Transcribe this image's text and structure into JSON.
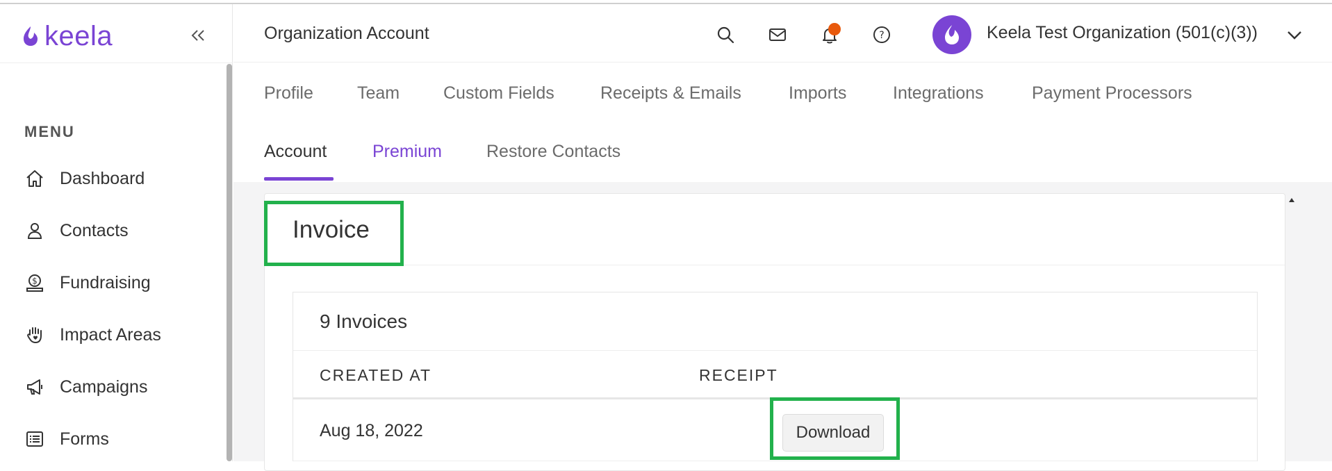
{
  "brand": {
    "logo_text": "keela",
    "accent": "#7a44d4"
  },
  "sidebar": {
    "menu_heading": "MENU",
    "items": [
      {
        "label": "Dashboard",
        "icon": "home-icon"
      },
      {
        "label": "Contacts",
        "icon": "person-icon"
      },
      {
        "label": "Fundraising",
        "icon": "donation-icon"
      },
      {
        "label": "Impact Areas",
        "icon": "hand-heart-icon"
      },
      {
        "label": "Campaigns",
        "icon": "megaphone-icon"
      },
      {
        "label": "Forms",
        "icon": "list-form-icon"
      }
    ]
  },
  "header": {
    "title": "Organization Account",
    "org_name": "Keela Test Organization (501(c)(3))",
    "notification_color": "#e8590c"
  },
  "tabs": {
    "row1": [
      "Profile",
      "Team",
      "Custom Fields",
      "Receipts & Emails",
      "Imports",
      "Integrations",
      "Payment Processors"
    ],
    "row2": [
      "Account",
      "Premium",
      "Restore Contacts"
    ],
    "active": "Account"
  },
  "invoice": {
    "title": "Invoice",
    "count_label": "9 Invoices",
    "columns": [
      "CREATED AT",
      "RECEIPT"
    ],
    "rows": [
      {
        "created_at": "Aug 18, 2022",
        "action": "Download"
      }
    ],
    "highlight_color": "#22b14c"
  }
}
